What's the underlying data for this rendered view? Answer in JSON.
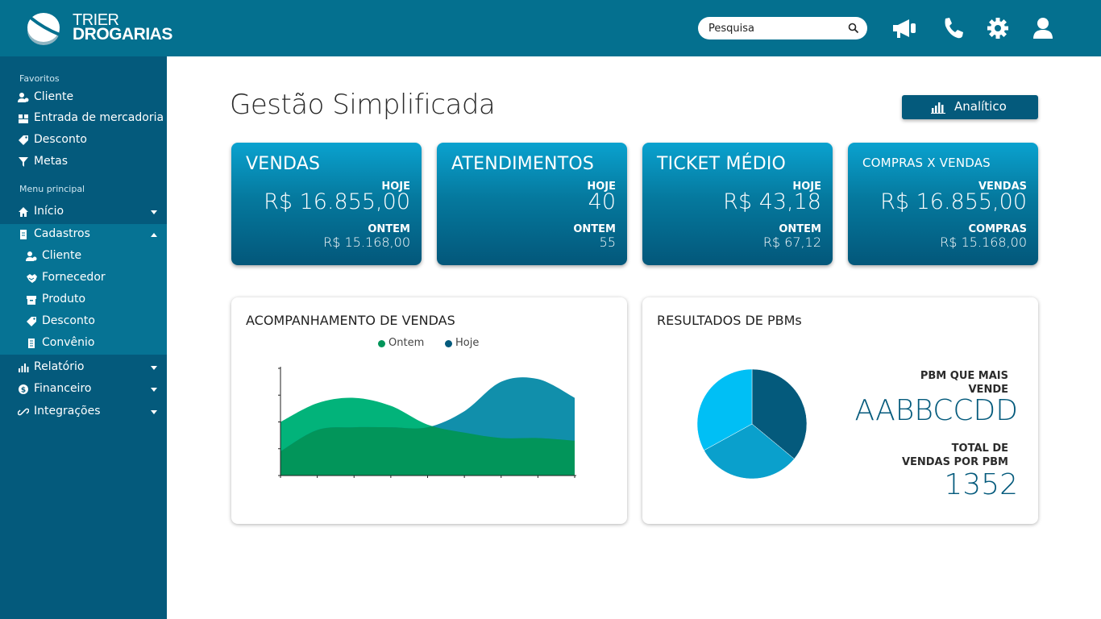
{
  "header": {
    "logo_line1": "TRIER",
    "logo_line2": "DROGARIAS",
    "search_placeholder": "Pesquisa",
    "icons": [
      "megaphone-icon",
      "phone-icon",
      "gear-icon",
      "user-icon"
    ]
  },
  "sidebar": {
    "favorites_label": "Favoritos",
    "favorites": [
      {
        "label": "Cliente",
        "icon": "user-icon"
      },
      {
        "label": "Entrada de mercadoria",
        "icon": "boxes-icon"
      },
      {
        "label": "Desconto",
        "icon": "tag-icon"
      },
      {
        "label": "Metas",
        "icon": "filter-icon"
      }
    ],
    "main_label": "Menu principal",
    "menu": [
      {
        "label": "Início",
        "icon": "home-icon",
        "expanded": false
      },
      {
        "label": "Cadastros",
        "icon": "file-icon",
        "expanded": true,
        "children": [
          {
            "label": "Cliente",
            "icon": "user-icon"
          },
          {
            "label": "Fornecedor",
            "icon": "handshake-icon"
          },
          {
            "label": "Produto",
            "icon": "box-icon"
          },
          {
            "label": "Desconto",
            "icon": "tag-icon"
          },
          {
            "label": "Convênio",
            "icon": "document-icon"
          }
        ]
      },
      {
        "label": "Relatório",
        "icon": "bar-chart-icon",
        "expanded": false
      },
      {
        "label": "Financeiro",
        "icon": "dollar-icon",
        "expanded": false
      },
      {
        "label": "Integrações",
        "icon": "link-icon",
        "expanded": false
      }
    ]
  },
  "main": {
    "title": "Gestão Simplificada",
    "analitico_label": "Analítico",
    "kpis": [
      {
        "title": "VENDAS",
        "label1": "HOJE",
        "value1": "R$ 16.855,00",
        "label2": "ONTEM",
        "value2": "R$ 15.168,00"
      },
      {
        "title": "ATENDIMENTOS",
        "label1": "HOJE",
        "value1": "40",
        "label2": "ONTEM",
        "value2": "55"
      },
      {
        "title": "TICKET MÉDIO",
        "label1": "HOJE",
        "value1": "R$ 43,18",
        "label2": "ONTEM",
        "value2": "R$ 67,12"
      },
      {
        "title": "COMPRAS X VENDAS",
        "label1": "VENDAS",
        "value1": "R$ 16.855,00",
        "label2": "COMPRAS",
        "value2": "R$ 15.168,00"
      }
    ],
    "sales_panel": {
      "title": "ACOMPANHAMENTO DE VENDAS"
    },
    "pbm_panel": {
      "title": "RESULTADOS DE PBMs",
      "top_label_line1": "PBM QUE MAIS",
      "top_label_line2": "VENDE",
      "top_value": "AABBCCDD",
      "total_label_line1": "TOTAL DE",
      "total_label_line2": "VENDAS POR PBM",
      "total_value": "1352"
    }
  },
  "colors": {
    "header": "#04708f",
    "sidebar": "#045a7c",
    "sidebar_expanded": "#067394",
    "accent_dark": "#045a7c",
    "ontem": "#02b37a",
    "hoje": "#0489a6"
  },
  "chart_data": [
    {
      "type": "area",
      "x": [
        0,
        1,
        2,
        3,
        4,
        5,
        6,
        7,
        8
      ],
      "series": [
        {
          "name": "Ontem",
          "color": "#02b37a",
          "values": [
            2.0,
            2.7,
            2.9,
            2.6,
            1.9,
            1.6,
            1.4,
            1.4,
            1.3
          ]
        },
        {
          "name": "Hoje",
          "color": "#0489a6",
          "values": [
            0.9,
            1.7,
            1.8,
            1.8,
            1.8,
            2.4,
            3.5,
            3.6,
            2.9
          ]
        }
      ],
      "ylim": [
        0,
        4
      ],
      "grid": false
    },
    {
      "type": "pie",
      "values": [
        36,
        31,
        33
      ],
      "colors": [
        "#045a7c",
        "#0aa0cc",
        "#00bff5"
      ]
    }
  ]
}
